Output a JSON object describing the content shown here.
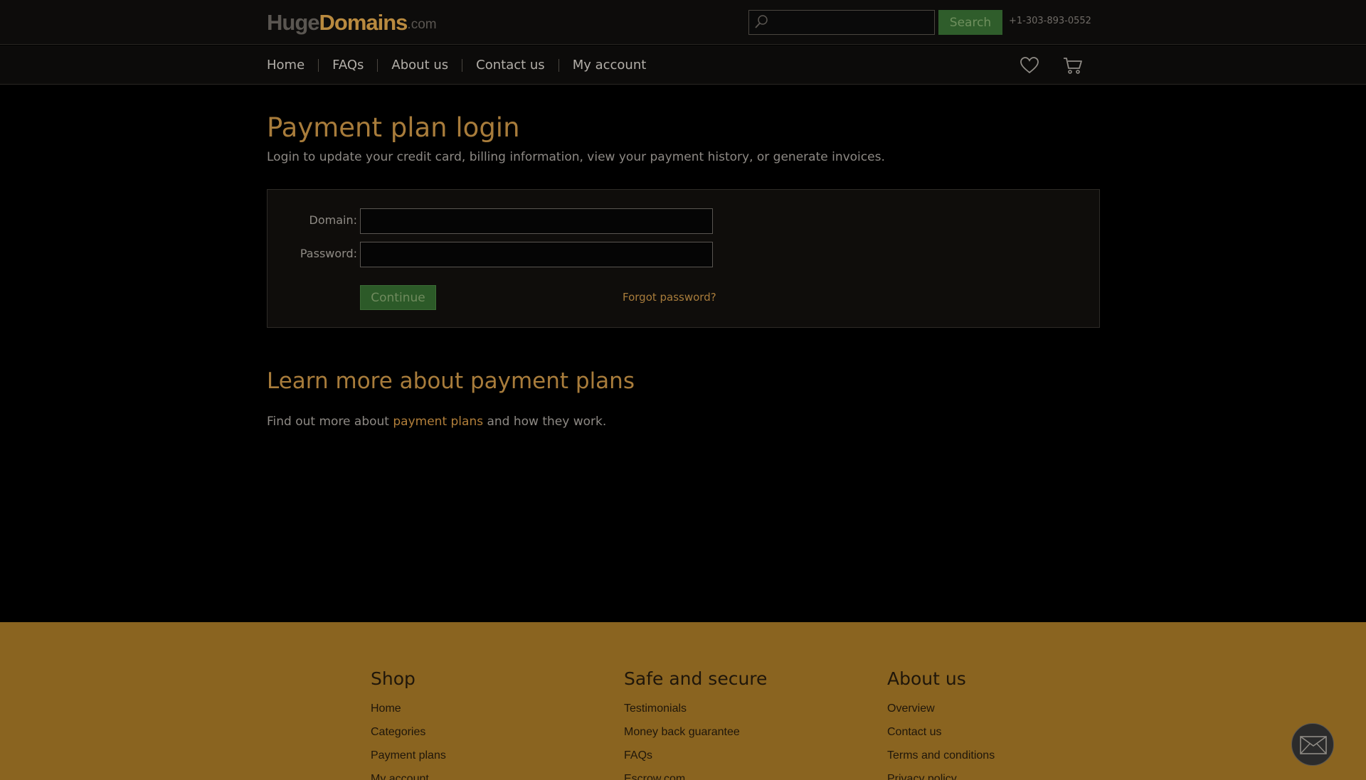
{
  "header": {
    "logo": {
      "part1": "Huge",
      "part2": "Domains",
      "part3": ".com"
    },
    "search": {
      "placeholder": "",
      "button_label": "Search"
    },
    "phone": "+1-303-893-0552"
  },
  "nav": {
    "items": [
      {
        "label": "Home"
      },
      {
        "label": "FAQs"
      },
      {
        "label": "About us"
      },
      {
        "label": "Contact us"
      },
      {
        "label": "My account"
      }
    ]
  },
  "main": {
    "title": "Payment plan login",
    "subtitle": "Login to update your credit card, billing information, view your payment history, or generate invoices.",
    "form": {
      "domain_label": "Domain:",
      "domain_value": "",
      "password_label": "Password:",
      "password_value": "",
      "continue_label": "Continue",
      "forgot_label": "Forgot password?"
    },
    "learn": {
      "title": "Learn more about payment plans",
      "text_before": "Find out more about ",
      "link": "payment plans",
      "text_after": " and how they work."
    }
  },
  "footer": {
    "shop": {
      "title": "Shop",
      "links": [
        "Home",
        "Categories",
        "Payment plans",
        "My account"
      ]
    },
    "safe": {
      "title": "Safe and secure",
      "links": [
        "Testimonials",
        "Money back guarantee",
        "FAQs",
        "Escrow.com"
      ]
    },
    "about": {
      "title": "About us",
      "links": [
        "Overview",
        "Contact us",
        "Terms and conditions",
        "Privacy policy"
      ]
    }
  },
  "icons": {
    "search": "search-icon",
    "heart": "heart-icon",
    "cart": "cart-icon",
    "chat": "envelope-icon"
  },
  "colors": {
    "accent": "#a87c3b",
    "button_green": "#2f5d2b",
    "footer_bg": "#8a6420"
  }
}
